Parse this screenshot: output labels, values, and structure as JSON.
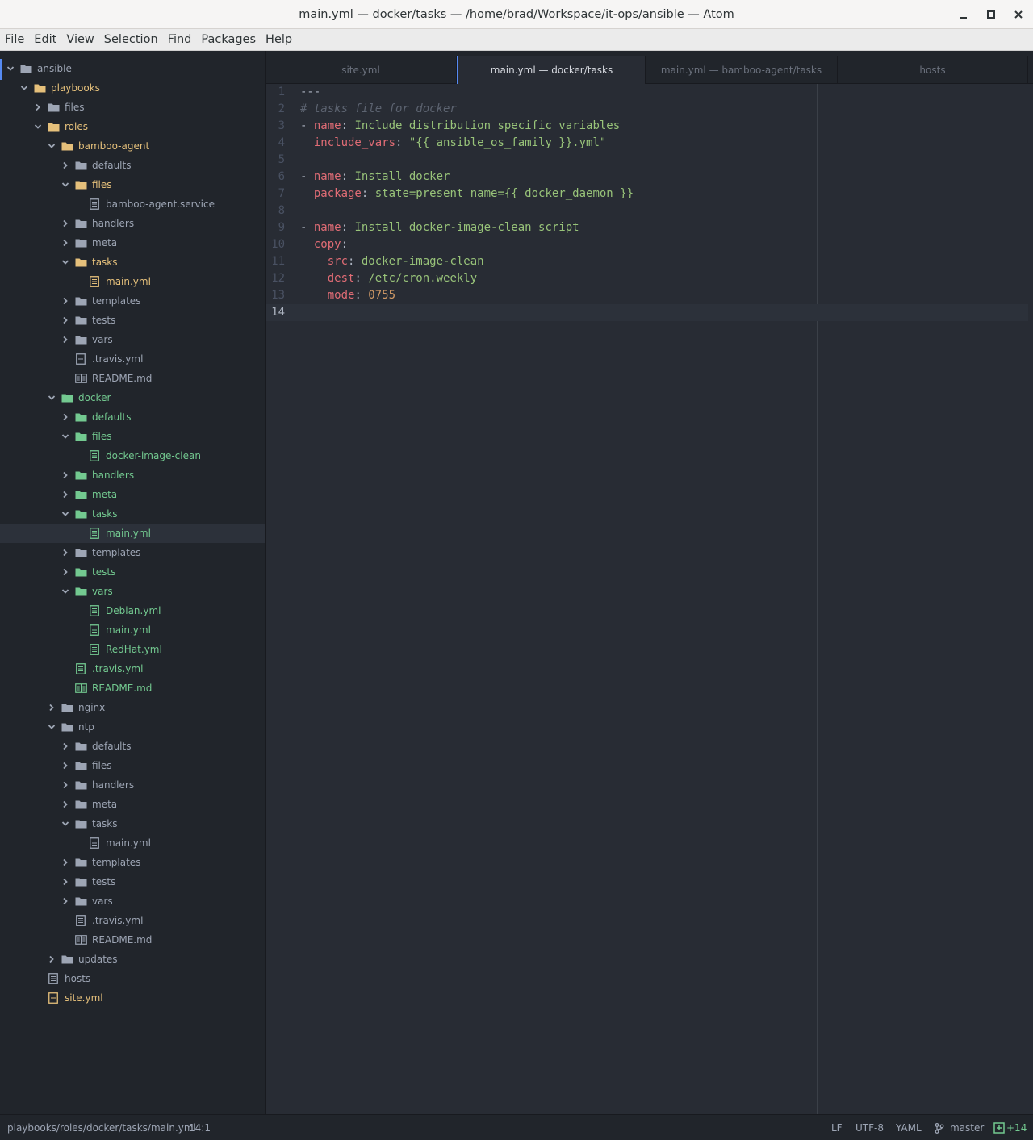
{
  "window": {
    "title": "main.yml — docker/tasks — /home/brad/Workspace/it-ops/ansible — Atom"
  },
  "menu": [
    "File",
    "Edit",
    "View",
    "Selection",
    "Find",
    "Packages",
    "Help"
  ],
  "tabs": [
    {
      "label": "site.yml",
      "active": false
    },
    {
      "label": "main.yml — docker/tasks",
      "active": true
    },
    {
      "label": "main.yml — bamboo-agent/tasks",
      "active": false
    },
    {
      "label": "hosts",
      "active": false
    }
  ],
  "tree": [
    {
      "label": "ansible",
      "type": "folder",
      "open": true,
      "depth": 0,
      "status": "default"
    },
    {
      "label": "playbooks",
      "type": "folder",
      "open": true,
      "depth": 1,
      "status": "modified"
    },
    {
      "label": "files",
      "type": "folder",
      "open": false,
      "depth": 2,
      "status": "default"
    },
    {
      "label": "roles",
      "type": "folder",
      "open": true,
      "depth": 2,
      "status": "modified"
    },
    {
      "label": "bamboo-agent",
      "type": "folder",
      "open": true,
      "depth": 3,
      "status": "modified"
    },
    {
      "label": "defaults",
      "type": "folder",
      "open": false,
      "depth": 4,
      "status": "default"
    },
    {
      "label": "files",
      "type": "folder",
      "open": true,
      "depth": 4,
      "status": "modified"
    },
    {
      "label": "bamboo-agent.service",
      "type": "file",
      "depth": 5,
      "status": "default"
    },
    {
      "label": "handlers",
      "type": "folder",
      "open": false,
      "depth": 4,
      "status": "default"
    },
    {
      "label": "meta",
      "type": "folder",
      "open": false,
      "depth": 4,
      "status": "default"
    },
    {
      "label": "tasks",
      "type": "folder",
      "open": true,
      "depth": 4,
      "status": "modified"
    },
    {
      "label": "main.yml",
      "type": "file",
      "depth": 5,
      "status": "modified"
    },
    {
      "label": "templates",
      "type": "folder",
      "open": false,
      "depth": 4,
      "status": "default"
    },
    {
      "label": "tests",
      "type": "folder",
      "open": false,
      "depth": 4,
      "status": "default"
    },
    {
      "label": "vars",
      "type": "folder",
      "open": false,
      "depth": 4,
      "status": "default"
    },
    {
      "label": ".travis.yml",
      "type": "file",
      "depth": 4,
      "status": "default"
    },
    {
      "label": "README.md",
      "type": "book",
      "depth": 4,
      "status": "default"
    },
    {
      "label": "docker",
      "type": "folder",
      "open": true,
      "depth": 3,
      "status": "added"
    },
    {
      "label": "defaults",
      "type": "folder",
      "open": false,
      "depth": 4,
      "status": "added"
    },
    {
      "label": "files",
      "type": "folder",
      "open": true,
      "depth": 4,
      "status": "added"
    },
    {
      "label": "docker-image-clean",
      "type": "file",
      "depth": 5,
      "status": "added"
    },
    {
      "label": "handlers",
      "type": "folder",
      "open": false,
      "depth": 4,
      "status": "added"
    },
    {
      "label": "meta",
      "type": "folder",
      "open": false,
      "depth": 4,
      "status": "added"
    },
    {
      "label": "tasks",
      "type": "folder",
      "open": true,
      "depth": 4,
      "status": "added"
    },
    {
      "label": "main.yml",
      "type": "file",
      "depth": 5,
      "status": "added",
      "selected": true
    },
    {
      "label": "templates",
      "type": "folder",
      "open": false,
      "depth": 4,
      "status": "default"
    },
    {
      "label": "tests",
      "type": "folder",
      "open": false,
      "depth": 4,
      "status": "added"
    },
    {
      "label": "vars",
      "type": "folder",
      "open": true,
      "depth": 4,
      "status": "added"
    },
    {
      "label": "Debian.yml",
      "type": "file",
      "depth": 5,
      "status": "added"
    },
    {
      "label": "main.yml",
      "type": "file",
      "depth": 5,
      "status": "added"
    },
    {
      "label": "RedHat.yml",
      "type": "file",
      "depth": 5,
      "status": "added"
    },
    {
      "label": ".travis.yml",
      "type": "file",
      "depth": 4,
      "status": "added"
    },
    {
      "label": "README.md",
      "type": "book",
      "depth": 4,
      "status": "added"
    },
    {
      "label": "nginx",
      "type": "folder",
      "open": false,
      "depth": 3,
      "status": "default"
    },
    {
      "label": "ntp",
      "type": "folder",
      "open": true,
      "depth": 3,
      "status": "default"
    },
    {
      "label": "defaults",
      "type": "folder",
      "open": false,
      "depth": 4,
      "status": "default"
    },
    {
      "label": "files",
      "type": "folder",
      "open": false,
      "depth": 4,
      "status": "default"
    },
    {
      "label": "handlers",
      "type": "folder",
      "open": false,
      "depth": 4,
      "status": "default"
    },
    {
      "label": "meta",
      "type": "folder",
      "open": false,
      "depth": 4,
      "status": "default"
    },
    {
      "label": "tasks",
      "type": "folder",
      "open": true,
      "depth": 4,
      "status": "default"
    },
    {
      "label": "main.yml",
      "type": "file",
      "depth": 5,
      "status": "default"
    },
    {
      "label": "templates",
      "type": "folder",
      "open": false,
      "depth": 4,
      "status": "default"
    },
    {
      "label": "tests",
      "type": "folder",
      "open": false,
      "depth": 4,
      "status": "default"
    },
    {
      "label": "vars",
      "type": "folder",
      "open": false,
      "depth": 4,
      "status": "default"
    },
    {
      "label": ".travis.yml",
      "type": "file",
      "depth": 4,
      "status": "default"
    },
    {
      "label": "README.md",
      "type": "book",
      "depth": 4,
      "status": "default"
    },
    {
      "label": "updates",
      "type": "folder",
      "open": false,
      "depth": 3,
      "status": "default"
    },
    {
      "label": "hosts",
      "type": "file",
      "depth": 2,
      "status": "default"
    },
    {
      "label": "site.yml",
      "type": "file",
      "depth": 2,
      "status": "modified"
    }
  ],
  "editor": {
    "cursor_line": 14,
    "lines": [
      [
        {
          "t": "---",
          "c": "fg"
        }
      ],
      [
        {
          "t": "# tasks file for docker",
          "c": "comment"
        }
      ],
      [
        {
          "t": "- ",
          "c": "dash"
        },
        {
          "t": "name",
          "c": "key"
        },
        {
          "t": ": ",
          "c": "punct"
        },
        {
          "t": "Include distribution specific variables",
          "c": "str"
        }
      ],
      [
        {
          "t": "  ",
          "c": "fg"
        },
        {
          "t": "include_vars",
          "c": "key"
        },
        {
          "t": ": ",
          "c": "punct"
        },
        {
          "t": "\"{{ ansible_os_family }}.yml\"",
          "c": "str"
        }
      ],
      [],
      [
        {
          "t": "- ",
          "c": "dash"
        },
        {
          "t": "name",
          "c": "key"
        },
        {
          "t": ": ",
          "c": "punct"
        },
        {
          "t": "Install docker",
          "c": "str"
        }
      ],
      [
        {
          "t": "  ",
          "c": "fg"
        },
        {
          "t": "package",
          "c": "key"
        },
        {
          "t": ": ",
          "c": "punct"
        },
        {
          "t": "state=present name={{ docker_daemon }}",
          "c": "str"
        }
      ],
      [],
      [
        {
          "t": "- ",
          "c": "dash"
        },
        {
          "t": "name",
          "c": "key"
        },
        {
          "t": ": ",
          "c": "punct"
        },
        {
          "t": "Install docker-image-clean script",
          "c": "str"
        }
      ],
      [
        {
          "t": "  ",
          "c": "fg"
        },
        {
          "t": "copy",
          "c": "key"
        },
        {
          "t": ":",
          "c": "punct"
        }
      ],
      [
        {
          "t": "    ",
          "c": "fg"
        },
        {
          "t": "src",
          "c": "key"
        },
        {
          "t": ": ",
          "c": "punct"
        },
        {
          "t": "docker-image-clean",
          "c": "str"
        }
      ],
      [
        {
          "t": "    ",
          "c": "fg"
        },
        {
          "t": "dest",
          "c": "key"
        },
        {
          "t": ": ",
          "c": "punct"
        },
        {
          "t": "/etc/cron.weekly",
          "c": "str"
        }
      ],
      [
        {
          "t": "    ",
          "c": "fg"
        },
        {
          "t": "mode",
          "c": "key"
        },
        {
          "t": ": ",
          "c": "punct"
        },
        {
          "t": "0755",
          "c": "num"
        }
      ],
      []
    ]
  },
  "status": {
    "path": "playbooks/roles/docker/tasks/main.yml",
    "position": "14:1",
    "line_ending": "LF",
    "encoding": "UTF-8",
    "grammar": "YAML",
    "branch": "master",
    "diff": "+14"
  },
  "colors": {
    "accent": "#568af2",
    "modified": "#e5c07b",
    "added": "#73c990"
  }
}
